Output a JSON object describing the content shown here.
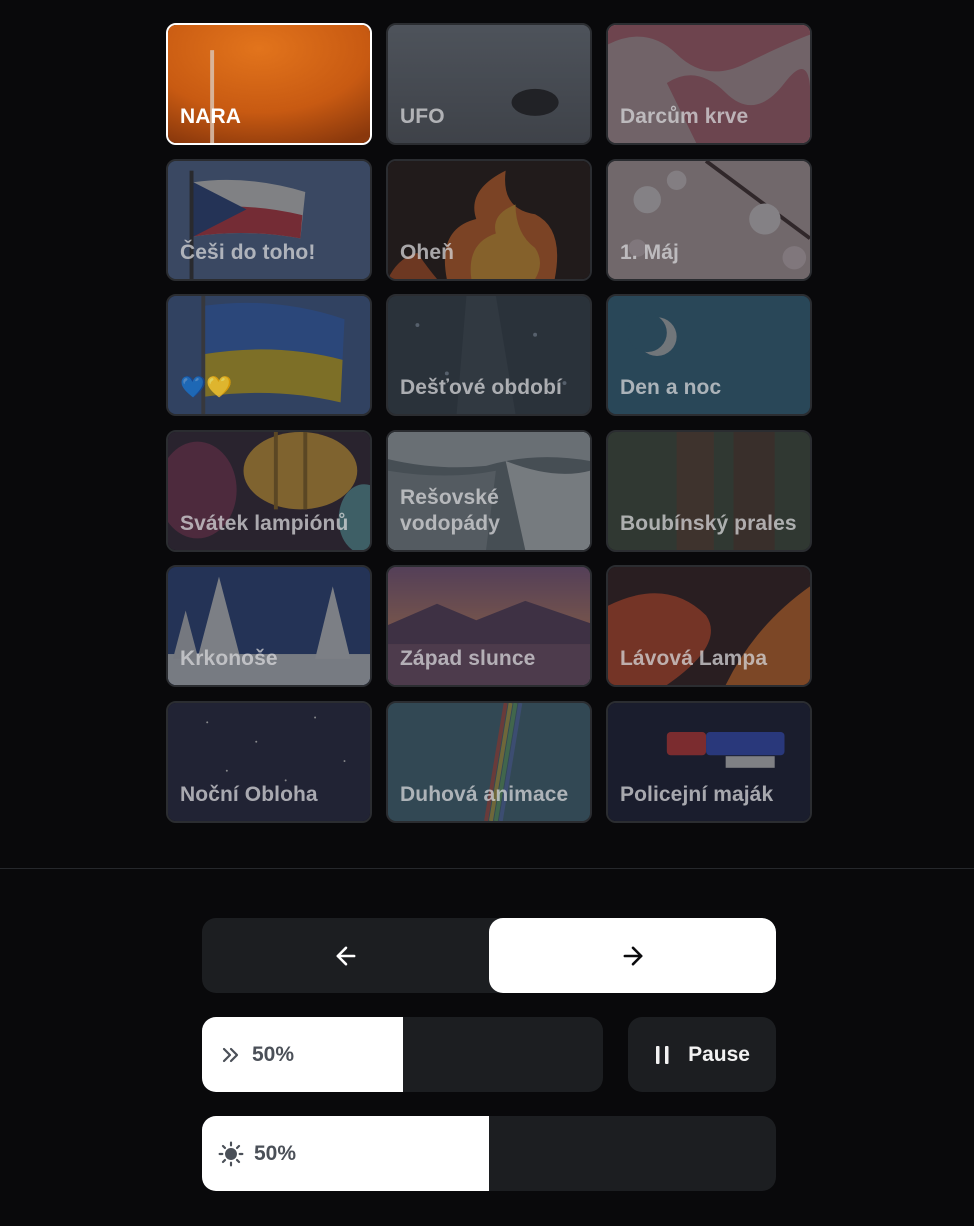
{
  "scenes": [
    {
      "label": "NARA",
      "active": true
    },
    {
      "label": "UFO",
      "active": false
    },
    {
      "label": "Darcům krve",
      "active": false
    },
    {
      "label": "Češi do toho!",
      "active": false
    },
    {
      "label": "Oheň",
      "active": false
    },
    {
      "label": "1. Máj",
      "active": false
    },
    {
      "label": "💙💛",
      "active": false
    },
    {
      "label": "Dešťové období",
      "active": false
    },
    {
      "label": "Den a noc",
      "active": false
    },
    {
      "label": "Svátek lampiónů",
      "active": false
    },
    {
      "label": "Rešovské vodopády",
      "active": false
    },
    {
      "label": "Boubínský prales",
      "active": false
    },
    {
      "label": "Krkonoše",
      "active": false
    },
    {
      "label": "Západ slunce",
      "active": false
    },
    {
      "label": "Lávová Lampa",
      "active": false
    },
    {
      "label": "Noční Obloha",
      "active": false
    },
    {
      "label": "Duhová animace",
      "active": false
    },
    {
      "label": "Policejní maják",
      "active": false
    }
  ],
  "controls": {
    "prev_icon": "arrow-left-icon",
    "next_icon": "arrow-right-icon",
    "speed": {
      "icon": "chevrons-right-icon",
      "value": 0.5,
      "label": "50%"
    },
    "pause": {
      "icon": "pause-icon",
      "label": "Pause"
    },
    "brightness": {
      "icon": "sun-icon",
      "value": 0.5,
      "label": "50%"
    }
  },
  "colors": {
    "background": "#09090b",
    "panel": "#1c1e21",
    "active_fill": "#ffffff",
    "muted_text": "#4b5058"
  }
}
